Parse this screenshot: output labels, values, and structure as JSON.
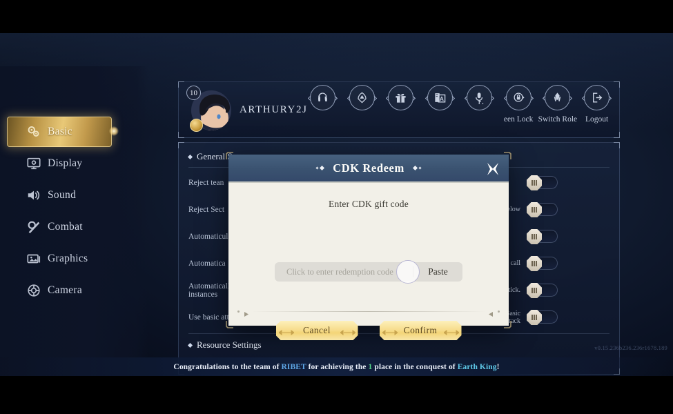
{
  "logo": {
    "name": "game-logo-arrow"
  },
  "sidebar": {
    "items": [
      {
        "label": "Basic",
        "icon": "gears-icon",
        "active": true
      },
      {
        "label": "Display",
        "icon": "monitor-icon",
        "active": false
      },
      {
        "label": "Sound",
        "icon": "speaker-icon",
        "active": false
      },
      {
        "label": "Combat",
        "icon": "sword-gear-icon",
        "active": false
      },
      {
        "label": "Graphics",
        "icon": "image-icon",
        "active": false
      },
      {
        "label": "Camera",
        "icon": "aperture-icon",
        "active": false
      }
    ]
  },
  "profile": {
    "level": "10",
    "name": "ARTHURY2J",
    "avatar_alt": "player-portrait",
    "actions": [
      {
        "label": "",
        "icon": "headset-icon"
      },
      {
        "label": "",
        "icon": "hood-icon"
      },
      {
        "label": "",
        "icon": "gift-icon"
      },
      {
        "label": "",
        "icon": "language-icon"
      },
      {
        "label": "",
        "icon": "voice-icon"
      },
      {
        "label": "een Lock",
        "icon": "screen-lock-icon"
      },
      {
        "label": "Switch Role",
        "icon": "switch-role-icon"
      },
      {
        "label": "Logout",
        "icon": "logout-icon"
      }
    ]
  },
  "settings": {
    "section_general": "General Se",
    "section_resource": "Resource Settings",
    "rows": [
      {
        "left": "Reject tean",
        "right": ""
      },
      {
        "left": "Reject Sect",
        "right": "below"
      },
      {
        "left": "Automaticul",
        "right": ""
      },
      {
        "left": "Automatica",
        "right": "ect call"
      },
      {
        "left": "Automatically agree to enter instances",
        "right": "Mount automatically using the joystick."
      },
      {
        "left": "Use basic attack to select target",
        "right": "Priority for External Soul Bone Basic Attack"
      }
    ]
  },
  "modal": {
    "title": "CDK Redeem",
    "prompt": "Enter CDK gift code",
    "input_value": "",
    "input_placeholder": "Click to enter redemption code",
    "paste_label": "Paste",
    "cancel_label": "Cancel",
    "confirm_label": "Confirm",
    "close_icon": "close-icon"
  },
  "banner": {
    "part1": "Congratulations to the team of ",
    "team": "RIBET",
    "part2": " for achieving the ",
    "place": "1",
    "part3": " place in the conquest of ",
    "boss": "Earth King",
    "part4": "!"
  },
  "version": "v0.15.236b236.236r1678.189",
  "colors": {
    "gold": "#e8c877",
    "modal_header": "#3a5270",
    "modal_body": "#f2f0e8",
    "panel_bg": "#16223a",
    "team_color": "#5fa8e8",
    "place_color": "#54d98a",
    "boss_color": "#5fc9e8"
  }
}
